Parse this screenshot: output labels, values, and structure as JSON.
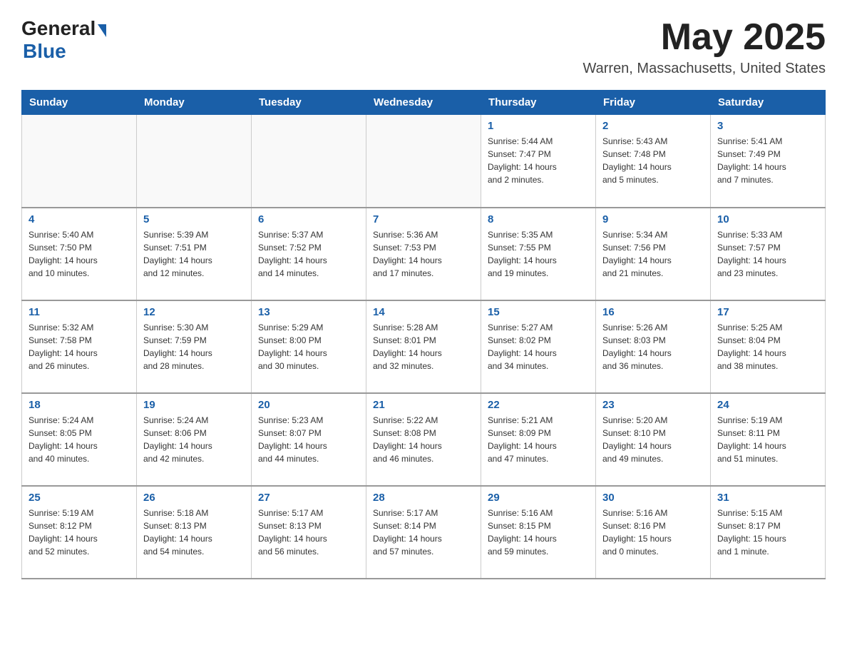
{
  "header": {
    "logo_general": "General",
    "logo_blue": "Blue",
    "month_title": "May 2025",
    "location": "Warren, Massachusetts, United States"
  },
  "weekdays": [
    "Sunday",
    "Monday",
    "Tuesday",
    "Wednesday",
    "Thursday",
    "Friday",
    "Saturday"
  ],
  "weeks": [
    [
      {
        "day": "",
        "info": ""
      },
      {
        "day": "",
        "info": ""
      },
      {
        "day": "",
        "info": ""
      },
      {
        "day": "",
        "info": ""
      },
      {
        "day": "1",
        "info": "Sunrise: 5:44 AM\nSunset: 7:47 PM\nDaylight: 14 hours\nand 2 minutes."
      },
      {
        "day": "2",
        "info": "Sunrise: 5:43 AM\nSunset: 7:48 PM\nDaylight: 14 hours\nand 5 minutes."
      },
      {
        "day": "3",
        "info": "Sunrise: 5:41 AM\nSunset: 7:49 PM\nDaylight: 14 hours\nand 7 minutes."
      }
    ],
    [
      {
        "day": "4",
        "info": "Sunrise: 5:40 AM\nSunset: 7:50 PM\nDaylight: 14 hours\nand 10 minutes."
      },
      {
        "day": "5",
        "info": "Sunrise: 5:39 AM\nSunset: 7:51 PM\nDaylight: 14 hours\nand 12 minutes."
      },
      {
        "day": "6",
        "info": "Sunrise: 5:37 AM\nSunset: 7:52 PM\nDaylight: 14 hours\nand 14 minutes."
      },
      {
        "day": "7",
        "info": "Sunrise: 5:36 AM\nSunset: 7:53 PM\nDaylight: 14 hours\nand 17 minutes."
      },
      {
        "day": "8",
        "info": "Sunrise: 5:35 AM\nSunset: 7:55 PM\nDaylight: 14 hours\nand 19 minutes."
      },
      {
        "day": "9",
        "info": "Sunrise: 5:34 AM\nSunset: 7:56 PM\nDaylight: 14 hours\nand 21 minutes."
      },
      {
        "day": "10",
        "info": "Sunrise: 5:33 AM\nSunset: 7:57 PM\nDaylight: 14 hours\nand 23 minutes."
      }
    ],
    [
      {
        "day": "11",
        "info": "Sunrise: 5:32 AM\nSunset: 7:58 PM\nDaylight: 14 hours\nand 26 minutes."
      },
      {
        "day": "12",
        "info": "Sunrise: 5:30 AM\nSunset: 7:59 PM\nDaylight: 14 hours\nand 28 minutes."
      },
      {
        "day": "13",
        "info": "Sunrise: 5:29 AM\nSunset: 8:00 PM\nDaylight: 14 hours\nand 30 minutes."
      },
      {
        "day": "14",
        "info": "Sunrise: 5:28 AM\nSunset: 8:01 PM\nDaylight: 14 hours\nand 32 minutes."
      },
      {
        "day": "15",
        "info": "Sunrise: 5:27 AM\nSunset: 8:02 PM\nDaylight: 14 hours\nand 34 minutes."
      },
      {
        "day": "16",
        "info": "Sunrise: 5:26 AM\nSunset: 8:03 PM\nDaylight: 14 hours\nand 36 minutes."
      },
      {
        "day": "17",
        "info": "Sunrise: 5:25 AM\nSunset: 8:04 PM\nDaylight: 14 hours\nand 38 minutes."
      }
    ],
    [
      {
        "day": "18",
        "info": "Sunrise: 5:24 AM\nSunset: 8:05 PM\nDaylight: 14 hours\nand 40 minutes."
      },
      {
        "day": "19",
        "info": "Sunrise: 5:24 AM\nSunset: 8:06 PM\nDaylight: 14 hours\nand 42 minutes."
      },
      {
        "day": "20",
        "info": "Sunrise: 5:23 AM\nSunset: 8:07 PM\nDaylight: 14 hours\nand 44 minutes."
      },
      {
        "day": "21",
        "info": "Sunrise: 5:22 AM\nSunset: 8:08 PM\nDaylight: 14 hours\nand 46 minutes."
      },
      {
        "day": "22",
        "info": "Sunrise: 5:21 AM\nSunset: 8:09 PM\nDaylight: 14 hours\nand 47 minutes."
      },
      {
        "day": "23",
        "info": "Sunrise: 5:20 AM\nSunset: 8:10 PM\nDaylight: 14 hours\nand 49 minutes."
      },
      {
        "day": "24",
        "info": "Sunrise: 5:19 AM\nSunset: 8:11 PM\nDaylight: 14 hours\nand 51 minutes."
      }
    ],
    [
      {
        "day": "25",
        "info": "Sunrise: 5:19 AM\nSunset: 8:12 PM\nDaylight: 14 hours\nand 52 minutes."
      },
      {
        "day": "26",
        "info": "Sunrise: 5:18 AM\nSunset: 8:13 PM\nDaylight: 14 hours\nand 54 minutes."
      },
      {
        "day": "27",
        "info": "Sunrise: 5:17 AM\nSunset: 8:13 PM\nDaylight: 14 hours\nand 56 minutes."
      },
      {
        "day": "28",
        "info": "Sunrise: 5:17 AM\nSunset: 8:14 PM\nDaylight: 14 hours\nand 57 minutes."
      },
      {
        "day": "29",
        "info": "Sunrise: 5:16 AM\nSunset: 8:15 PM\nDaylight: 14 hours\nand 59 minutes."
      },
      {
        "day": "30",
        "info": "Sunrise: 5:16 AM\nSunset: 8:16 PM\nDaylight: 15 hours\nand 0 minutes."
      },
      {
        "day": "31",
        "info": "Sunrise: 5:15 AM\nSunset: 8:17 PM\nDaylight: 15 hours\nand 1 minute."
      }
    ]
  ]
}
